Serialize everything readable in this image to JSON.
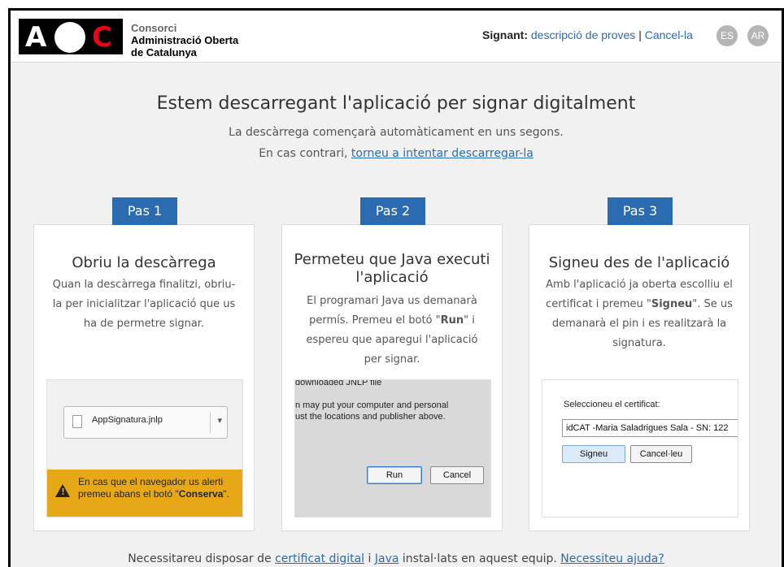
{
  "header": {
    "logo": {
      "a": "A",
      "c": "C"
    },
    "org": [
      "Consorci",
      "Administració Oberta",
      "de Catalunya"
    ],
    "signant_label": "Signant:",
    "signant_desc": "descripció de proves",
    "separator": "|",
    "cancel_link": "Cancel-la",
    "langs": [
      "ES",
      "AR"
    ]
  },
  "main": {
    "title": "Estem descarregant l'aplicació per signar digitalment",
    "subtitle": "La descàrrega començarà automàticament en uns segons.",
    "retry_prefix": "En cas contrari,",
    "retry_link": "torneu a intentar descarregar-la"
  },
  "steps": [
    {
      "tag": "Pas 1",
      "title": "Obriu la descàrrega",
      "text": "Quan la descàrrega finalitzi, obriu-la per inicialitzar l'aplicació que us ha de permetre signar.",
      "file": "AppSignatura.jnlp",
      "warn_a": "En cas que el navegador us alerti premeu abans el botó \"",
      "warn_b": "Conserva",
      "warn_c": "\"."
    },
    {
      "tag": "Pas 2",
      "title": "Permeteu que Java executi l'aplicació",
      "text_a": "El programari Java us demanarà permís. Premeu el botó \"",
      "text_b": "Run",
      "text_c": "\" i espereu que aparegui l'aplicació per signar.",
      "shot_l1": "downloaded JNLP file",
      "shot_l2": "n may put your computer and personal",
      "shot_l3": "ust the locations and publisher above.",
      "run": "Run",
      "cancel": "Cancel"
    },
    {
      "tag": "Pas 3",
      "title": "Signeu des de l'aplicació",
      "text_a": "Amb l'aplicació ja oberta escolliu el certificat i premeu \"",
      "text_b": "Signeu",
      "text_c": "\". Se us demanarà el pin i es realitzarà la signatura.",
      "label": "Seleccioneu el certificat:",
      "cert": "idCAT -Maria Saladrigues Sala - SN: 122",
      "sign": "Signeu",
      "cancel": "Cancel·leu"
    }
  ],
  "footer": {
    "prefix": "Necessitareu disposar de",
    "cert_link": "certificat digital",
    "mid": "i",
    "java_link": "Java",
    "suffix": "instal·lats en aquest equip.",
    "help_link": "Necessiteu ajuda?"
  },
  "colors": {
    "accent": "#2b6cb0",
    "warning": "#e6a817",
    "logo_red": "#e30613"
  }
}
